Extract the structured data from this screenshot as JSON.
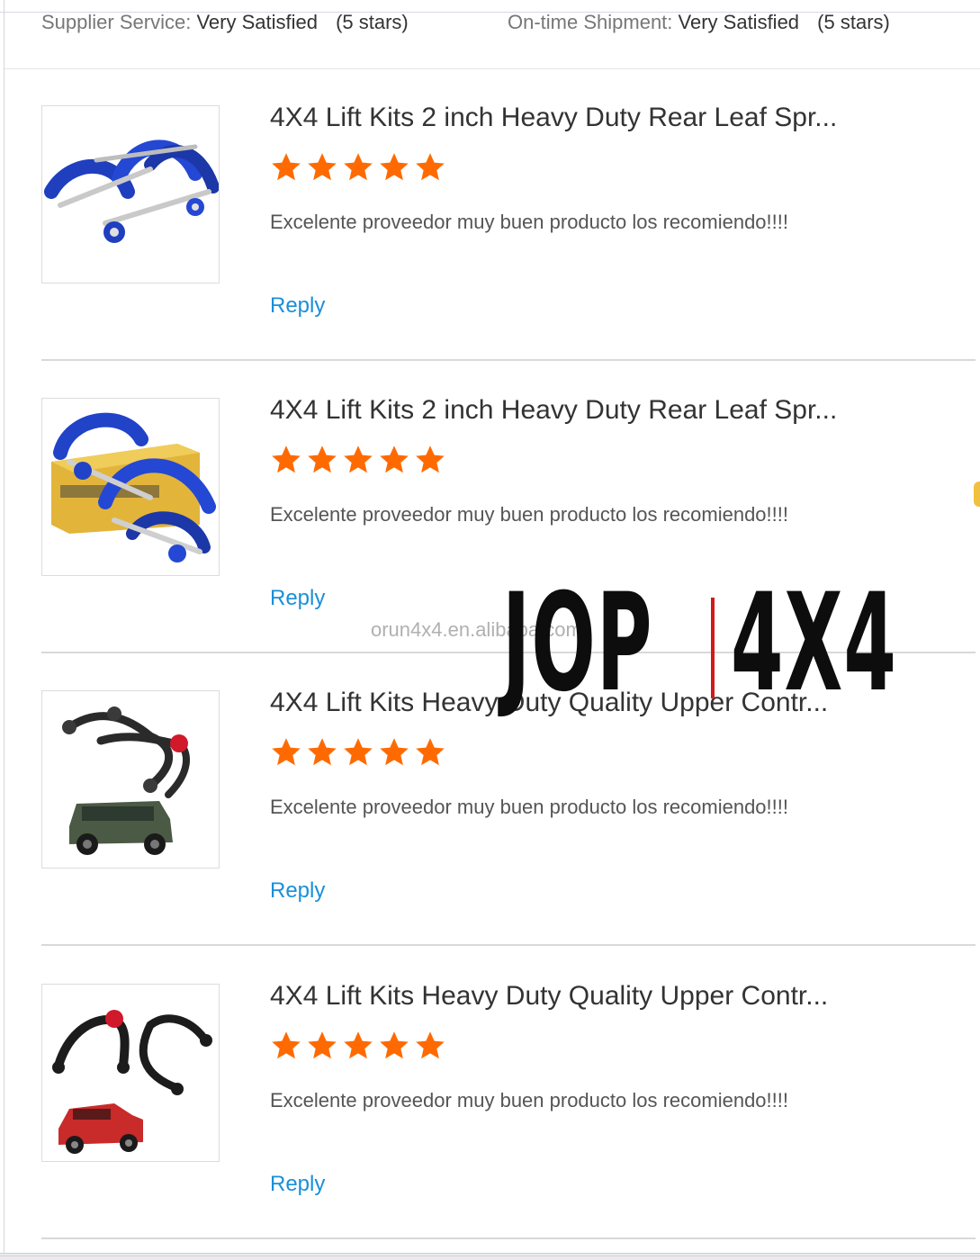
{
  "summary": {
    "supplier_service": {
      "label": "Supplier Service:",
      "value": "Very Satisfied",
      "stars": "(5 stars)"
    },
    "on_time_shipment": {
      "label": "On-time Shipment:",
      "value": "Very Satisfied",
      "stars": "(5 stars)"
    }
  },
  "reviews": [
    {
      "title": "4X4 Lift Kits 2 inch Heavy Duty Rear Leaf Spr...",
      "rating": 5,
      "comment": "Excelente proveedor muy buen producto los recomiendo!!!!",
      "reply_label": "Reply",
      "image": "blue-leaf-spring-shackle"
    },
    {
      "title": "4X4 Lift Kits 2 inch Heavy Duty Rear Leaf Spr...",
      "rating": 5,
      "comment": "Excelente proveedor muy buen producto los recomiendo!!!!",
      "reply_label": "Reply",
      "image": "blue-leaf-spring-shackle-with-box"
    },
    {
      "title": "4X4 Lift Kits Heavy Duty Quality Upper Contr...",
      "rating": 5,
      "comment": "Excelente proveedor muy buen producto los recomiendo!!!!",
      "reply_label": "Reply",
      "image": "upper-control-arms-green-suv"
    },
    {
      "title": "4X4 Lift Kits Heavy Duty Quality Upper Contr...",
      "rating": 5,
      "comment": "Excelente proveedor muy buen producto los recomiendo!!!!",
      "reply_label": "Reply",
      "image": "upper-control-arms-red-pickup"
    }
  ],
  "watermark": {
    "url": "orun4x4.en.alibaba.com",
    "brand_left": "JOP",
    "brand_right": "4X4"
  },
  "colors": {
    "star": "#ff6a00",
    "link": "#1a8fd8",
    "divider": "#d9d9d9",
    "brand_bar": "#d11a1a"
  }
}
